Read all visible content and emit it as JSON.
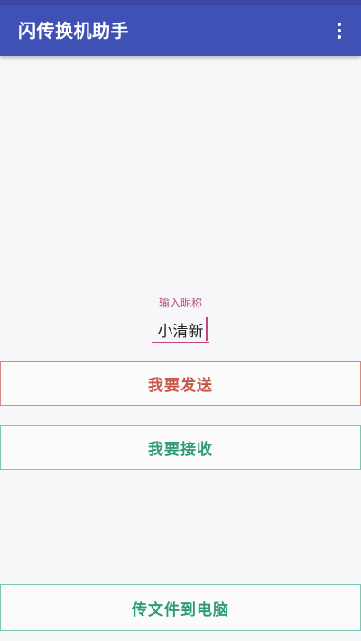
{
  "app_bar": {
    "title": "闪传换机助手",
    "menu_icon": "more-vert-icon"
  },
  "nickname": {
    "label": "输入昵称",
    "value": "小清新"
  },
  "buttons": {
    "send": "我要发送",
    "receive": "我要接收",
    "to_pc": "传文件到电脑"
  },
  "colors": {
    "primary": "#3f51b5",
    "accent": "#c2457d",
    "send": "#c8574a",
    "receive": "#2f9a7c"
  }
}
